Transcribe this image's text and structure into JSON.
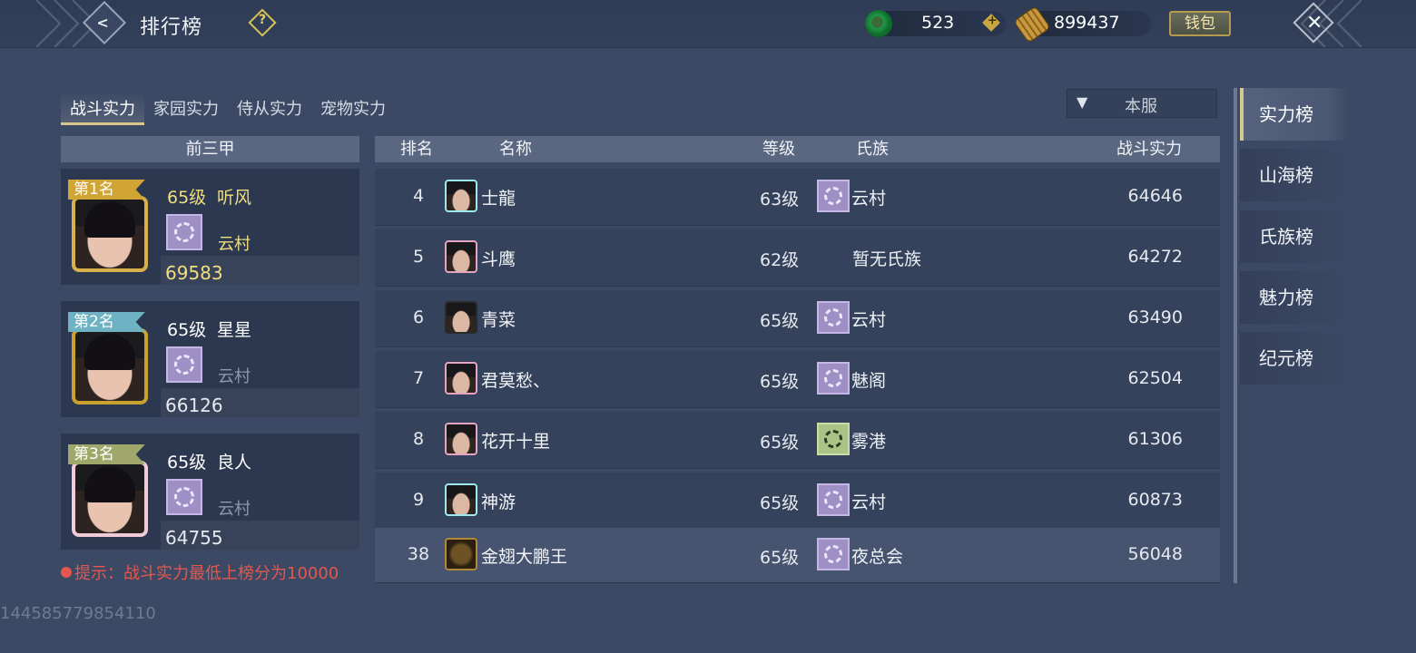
{
  "header": {
    "title": "排行榜",
    "jade": "523",
    "coins": "899437",
    "wallet_label": "钱包"
  },
  "tabs": [
    {
      "label": "战斗实力",
      "active": true
    },
    {
      "label": "家园实力",
      "active": false
    },
    {
      "label": "侍从实力",
      "active": false
    },
    {
      "label": "宠物实力",
      "active": false
    }
  ],
  "server_filter": {
    "selected": "本服"
  },
  "top_three": {
    "title": "前三甲",
    "entries": [
      {
        "rank_label": "第1名",
        "level": "65级",
        "name": "听风",
        "clan": "云村",
        "power": "69583",
        "ribbon_color": "#d1a436",
        "frame_color": "#d7b04a",
        "text_color": "#f1de7d"
      },
      {
        "rank_label": "第2名",
        "level": "65级",
        "name": "星星",
        "clan": "云村",
        "power": "66126",
        "ribbon_color": "#6fb2c4",
        "frame_color": "#c9a22e",
        "text_color": "#e6e9ef"
      },
      {
        "rank_label": "第3名",
        "level": "65级",
        "name": "良人",
        "clan": "云村",
        "power": "64755",
        "ribbon_color": "#9fa86a",
        "frame_color": "#f1cbd7",
        "text_color": "#e6e9ef"
      }
    ]
  },
  "hint": "提示：战斗实力最低上榜分为10000",
  "uid": "144585779854110",
  "list": {
    "columns": {
      "rank": "排名",
      "name": "名称",
      "level": "等级",
      "clan": "氏族",
      "power": "战斗实力"
    },
    "rows": [
      {
        "rank": "4",
        "name": "士龍",
        "level": "63级",
        "clan": "云村",
        "power": "64646",
        "avatar_style": "cyan",
        "emblem": "purple"
      },
      {
        "rank": "5",
        "name": "斗鹰",
        "level": "62级",
        "clan": "暂无氏族",
        "power": "64272",
        "avatar_style": "pink",
        "emblem": "none"
      },
      {
        "rank": "6",
        "name": "青菜",
        "level": "65级",
        "clan": "云村",
        "power": "63490",
        "avatar_style": "dark",
        "emblem": "purple"
      },
      {
        "rank": "7",
        "name": "君莫愁、",
        "level": "65级",
        "clan": "魅阁",
        "power": "62504",
        "avatar_style": "pink",
        "emblem": "purple"
      },
      {
        "rank": "8",
        "name": "花开十里",
        "level": "65级",
        "clan": "雾港",
        "power": "61306",
        "avatar_style": "pink",
        "emblem": "green"
      },
      {
        "rank": "9",
        "name": "神游",
        "level": "65级",
        "clan": "云村",
        "power": "60873",
        "avatar_style": "cyan",
        "emblem": "purple"
      }
    ],
    "self_row": {
      "rank": "38",
      "name": "金翅大鹏王",
      "level": "65级",
      "clan": "夜总会",
      "power": "56048",
      "avatar_style": "gold",
      "emblem": "purple"
    }
  },
  "side_nav": [
    {
      "label": "实力榜",
      "active": true
    },
    {
      "label": "山海榜",
      "active": false
    },
    {
      "label": "氏族榜",
      "active": false
    },
    {
      "label": "魅力榜",
      "active": false
    },
    {
      "label": "纪元榜",
      "active": false
    }
  ]
}
